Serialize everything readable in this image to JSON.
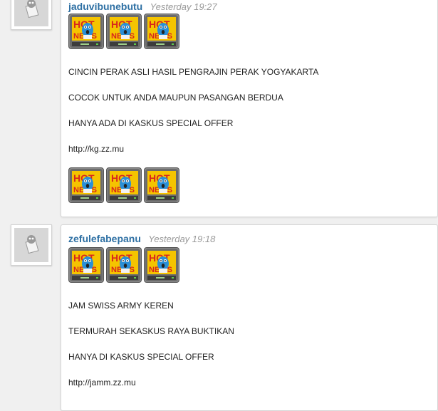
{
  "posts": [
    {
      "username": "jaduvibunebutu",
      "timestamp": "Yesterday 19:27",
      "emote_icon": "hot-news-emoticon",
      "lines": [
        "CINCIN PERAK ASLI HASIL PENGRAJIN PERAK YOGYAKARTA",
        "COCOK UNTUK ANDA MAUPUN PASANGAN BERDUA",
        "HANYA ADA DI KASKUS SPECIAL OFFER"
      ],
      "link": "http://kg.zz.mu"
    },
    {
      "username": "zefulefabepanu",
      "timestamp": "Yesterday 19:18",
      "emote_icon": "hot-news-emoticon",
      "lines": [
        "JAM SWISS ARMY KEREN",
        "TERMURAH SEKASKUS RAYA BUKTIKAN",
        "HANYA DI KASKUS SPECIAL OFFER"
      ],
      "link": "http://jamm.zz.mu"
    }
  ],
  "emote_text": {
    "hot": "HOT",
    "news": "NEWS"
  },
  "colors": {
    "username": "#2d6fa3",
    "timestamp": "#999999",
    "hot_red": "#d8261c",
    "hot_yellow": "#f5c400",
    "mascot_blue": "#2b8fd6"
  }
}
